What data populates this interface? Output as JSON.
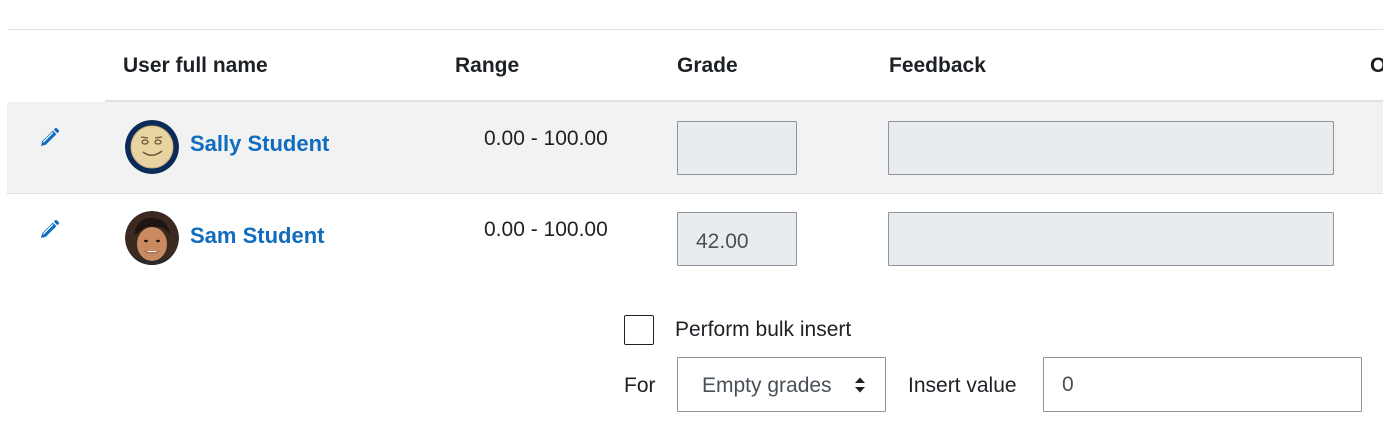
{
  "table": {
    "columns": [
      {
        "label": "User full name"
      },
      {
        "label": "Range"
      },
      {
        "label": "Grade"
      },
      {
        "label": "Feedback"
      },
      {
        "label": "O"
      }
    ],
    "rows": [
      {
        "name": "Sally Student",
        "range": "0.00 - 100.00",
        "grade": "",
        "feedback": "",
        "avatar_icon": "smiley-avatar-icon"
      },
      {
        "name": "Sam Student",
        "range": "0.00 - 100.00",
        "grade": "42.00",
        "feedback": "",
        "avatar_icon": "photo-avatar-icon"
      }
    ]
  },
  "bulk": {
    "checkbox_label": "Perform bulk insert",
    "checked": false,
    "for_label": "For",
    "for_value": "Empty grades",
    "insert_label": "Insert value",
    "insert_value": "0"
  },
  "icons": {
    "edit": "pencil-icon"
  },
  "colors": {
    "link": "#0f6cbf",
    "row_stripe": "#f2f2f2",
    "input_disabled_bg": "#e9ecef"
  }
}
